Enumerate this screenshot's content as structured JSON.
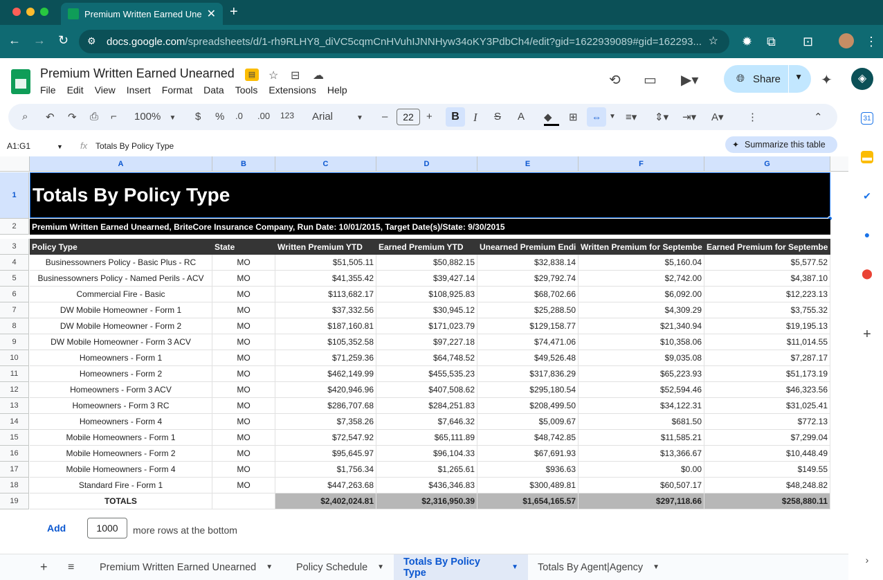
{
  "browser": {
    "tab_title": "Premium Written Earned Unearned",
    "url_host": "docs.google.com",
    "url_path": "/spreadsheets/d/1-rh9RLHY8_diVC5cqmCnHVuhIJNNHyw34oKY3PdbCh4/edit?gid=1622939089#gid=162293..."
  },
  "doc": {
    "title": "Premium Written Earned Unearned",
    "menu": [
      "File",
      "Edit",
      "View",
      "Insert",
      "Format",
      "Data",
      "Tools",
      "Extensions",
      "Help"
    ],
    "share_label": "Share"
  },
  "toolbar": {
    "zoom": "100%",
    "currency": "$",
    "percent": "%",
    "dec_less": ".0",
    "dec_more": ".00",
    "num_format": "123",
    "font": "Arial",
    "font_size": "22"
  },
  "formula_bar": {
    "name_box": "A1:G1",
    "content": "Totals By Policy Type",
    "summarize_label": "Summarize this table"
  },
  "grid": {
    "columns": [
      "A",
      "B",
      "C",
      "D",
      "E",
      "F",
      "G"
    ],
    "title": "Totals By Policy Type",
    "subtitle": "Premium Written Earned Unearned, BriteCore Insurance Company, Run Date: 10/01/2015, Target Date(s)/State: 9/30/2015",
    "headers": [
      "Policy Type",
      "State",
      "Written Premium YTD",
      "Earned Premium YTD",
      "Unearned Premium Endi",
      "Written Premium for Septembe",
      "Earned Premium for Septembe"
    ],
    "rows": [
      [
        "Businessowners Policy - Basic Plus - RC",
        "MO",
        "$51,505.11",
        "$50,882.15",
        "$32,838.14",
        "$5,160.04",
        "$5,577.52"
      ],
      [
        "Businessowners Policy - Named Perils - ACV",
        "MO",
        "$41,355.42",
        "$39,427.14",
        "$29,792.74",
        "$2,742.00",
        "$4,387.10"
      ],
      [
        "Commercial Fire - Basic",
        "MO",
        "$113,682.17",
        "$108,925.83",
        "$68,702.66",
        "$6,092.00",
        "$12,223.13"
      ],
      [
        "DW Mobile Homeowner - Form 1",
        "MO",
        "$37,332.56",
        "$30,945.12",
        "$25,288.50",
        "$4,309.29",
        "$3,755.32"
      ],
      [
        "DW Mobile Homeowner - Form 2",
        "MO",
        "$187,160.81",
        "$171,023.79",
        "$129,158.77",
        "$21,340.94",
        "$19,195.13"
      ],
      [
        "DW Mobile Homeowner - Form 3 ACV",
        "MO",
        "$105,352.58",
        "$97,227.18",
        "$74,471.06",
        "$10,358.06",
        "$11,014.55"
      ],
      [
        "Homeowners - Form 1",
        "MO",
        "$71,259.36",
        "$64,748.52",
        "$49,526.48",
        "$9,035.08",
        "$7,287.17"
      ],
      [
        "Homeowners - Form 2",
        "MO",
        "$462,149.99",
        "$455,535.23",
        "$317,836.29",
        "$65,223.93",
        "$51,173.19"
      ],
      [
        "Homeowners - Form 3 ACV",
        "MO",
        "$420,946.96",
        "$407,508.62",
        "$295,180.54",
        "$52,594.46",
        "$46,323.56"
      ],
      [
        "Homeowners - Form 3 RC",
        "MO",
        "$286,707.68",
        "$284,251.83",
        "$208,499.50",
        "$34,122.31",
        "$31,025.41"
      ],
      [
        "Homeowners - Form 4",
        "MO",
        "$7,358.26",
        "$7,646.32",
        "$5,009.67",
        "$681.50",
        "$772.13"
      ],
      [
        "Mobile Homeowners - Form 1",
        "MO",
        "$72,547.92",
        "$65,111.89",
        "$48,742.85",
        "$11,585.21",
        "$7,299.04"
      ],
      [
        "Mobile Homeowners - Form 2",
        "MO",
        "$95,645.97",
        "$96,104.33",
        "$67,691.93",
        "$13,366.67",
        "$10,448.49"
      ],
      [
        "Mobile Homeowners - Form 4",
        "MO",
        "$1,756.34",
        "$1,265.61",
        "$936.63",
        "$0.00",
        "$149.55"
      ],
      [
        "Standard Fire - Form 1",
        "MO",
        "$447,263.68",
        "$436,346.83",
        "$300,489.81",
        "$60,507.17",
        "$48,248.82"
      ]
    ],
    "totals": [
      "TOTALS",
      "",
      "$2,402,024.81",
      "$2,316,950.39",
      "$1,654,165.57",
      "$297,118.66",
      "$258,880.11"
    ]
  },
  "add_rows": {
    "button": "Add",
    "count": "1000",
    "suffix": "more rows at the bottom"
  },
  "sheet_tabs": [
    {
      "label": "Premium Written Earned Unearned",
      "active": false
    },
    {
      "label": "Policy Schedule",
      "active": false
    },
    {
      "label": "Totals By Policy Type",
      "active": true
    },
    {
      "label": "Totals By Agent|Agency",
      "active": false
    }
  ]
}
